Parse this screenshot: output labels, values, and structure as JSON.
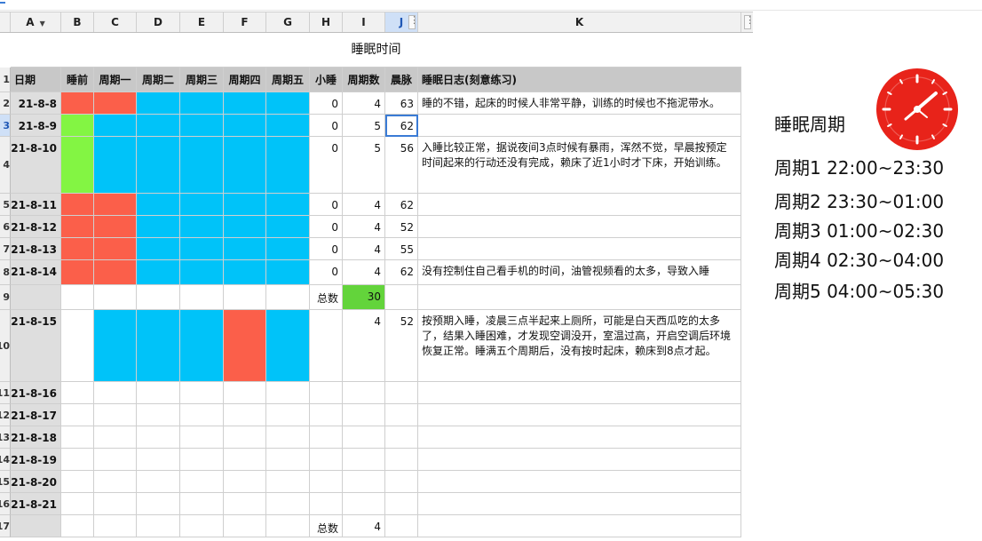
{
  "columns": [
    "A",
    "B",
    "C",
    "D",
    "E",
    "F",
    "G",
    "H",
    "I",
    "J",
    "K"
  ],
  "selected_column": "J",
  "sheet_title": "睡眠时间",
  "headers": {
    "date": "日期",
    "before_sleep": "睡前",
    "c1": "周期一",
    "c2": "周期二",
    "c3": "周期三",
    "c4": "周期四",
    "c5": "周期五",
    "nap": "小睡",
    "cycles": "周期数",
    "pulse": "晨脉",
    "log": "睡眠日志(刻意练习)"
  },
  "header_row_number": "1",
  "rows": [
    {
      "rn": "2",
      "date": "21-8-8",
      "nap": "0",
      "cycles": "4",
      "pulse": "63",
      "log": "睡的不错，起床的时候人非常平静，训练的时候也不拖泥带水。"
    },
    {
      "rn": "3",
      "date": "21-8-9",
      "nap": "0",
      "cycles": "5",
      "pulse": "62",
      "log": ""
    },
    {
      "rn": "4",
      "date": "21-8-10",
      "nap": "0",
      "cycles": "5",
      "pulse": "56",
      "log": "入睡比较正常，据说夜间3点时候有暴雨，浑然不觉，早晨按预定时间起来的行动还没有完成，赖床了近1小时才下床，开始训练。"
    },
    {
      "rn": "5",
      "date": "21-8-11",
      "nap": "0",
      "cycles": "4",
      "pulse": "62",
      "log": ""
    },
    {
      "rn": "6",
      "date": "21-8-12",
      "nap": "0",
      "cycles": "4",
      "pulse": "52",
      "log": ""
    },
    {
      "rn": "7",
      "date": "21-8-13",
      "nap": "0",
      "cycles": "4",
      "pulse": "55",
      "log": ""
    },
    {
      "rn": "8",
      "date": "21-8-14",
      "nap": "0",
      "cycles": "4",
      "pulse": "62",
      "log": "没有控制住自己看手机的时间，油管视频看的太多，导致入睡"
    },
    {
      "rn": "9",
      "date": "",
      "nap": "总数",
      "cycles": "30",
      "pulse": "",
      "log": ""
    },
    {
      "rn": "10",
      "date": "21-8-15",
      "nap": "",
      "cycles": "4",
      "pulse": "52",
      "log": "按预期入睡，凌晨三点半起来上厕所，可能是白天西瓜吃的太多了，结果入睡困难，才发现空调没开，室温过高，开启空调后环境恢复正常。睡满五个周期后，没有按时起床，赖床到8点才起。"
    },
    {
      "rn": "11",
      "date": "21-8-16",
      "nap": "",
      "cycles": "",
      "pulse": "",
      "log": ""
    },
    {
      "rn": "12",
      "date": "21-8-17",
      "nap": "",
      "cycles": "",
      "pulse": "",
      "log": ""
    },
    {
      "rn": "13",
      "date": "21-8-18",
      "nap": "",
      "cycles": "",
      "pulse": "",
      "log": ""
    },
    {
      "rn": "14",
      "date": "21-8-19",
      "nap": "",
      "cycles": "",
      "pulse": "",
      "log": ""
    },
    {
      "rn": "15",
      "date": "21-8-20",
      "nap": "",
      "cycles": "",
      "pulse": "",
      "log": ""
    },
    {
      "rn": "16",
      "date": "21-8-21",
      "nap": "",
      "cycles": "",
      "pulse": "",
      "log": ""
    },
    {
      "rn": "17",
      "date": "",
      "nap": "总数",
      "cycles": "4",
      "pulse": "",
      "log": ""
    }
  ],
  "cell_fills": [
    [
      "red",
      "red",
      "blue",
      "blue",
      "blue",
      "blue"
    ],
    [
      "green",
      "blue",
      "blue",
      "blue",
      "blue",
      "blue"
    ],
    [
      "green",
      "blue",
      "blue",
      "blue",
      "blue",
      "blue"
    ],
    [
      "red",
      "red",
      "blue",
      "blue",
      "blue",
      "blue"
    ],
    [
      "red",
      "red",
      "blue",
      "blue",
      "blue",
      "blue"
    ],
    [
      "red",
      "red",
      "blue",
      "blue",
      "blue",
      "blue"
    ],
    [
      "red",
      "red",
      "blue",
      "blue",
      "blue",
      "blue"
    ],
    [
      "",
      "",
      "",
      "",
      "",
      ""
    ],
    [
      "",
      "blue",
      "blue",
      "blue",
      "red",
      "blue"
    ],
    [
      "",
      "",
      "",
      "",
      "",
      ""
    ],
    [
      "",
      "",
      "",
      "",
      "",
      ""
    ],
    [
      "",
      "",
      "",
      "",
      "",
      ""
    ],
    [
      "",
      "",
      "",
      "",
      "",
      ""
    ],
    [
      "",
      "",
      "",
      "",
      "",
      ""
    ],
    [
      "",
      "",
      "",
      "",
      "",
      ""
    ],
    [
      "",
      "",
      "",
      "",
      "",
      ""
    ]
  ],
  "colors": {
    "red": "#fb5f4a",
    "blue": "#00c3f9",
    "green": "#83f543",
    "sum_green": "#63d43b",
    "clock_red": "#e8231a",
    "selection": "#3a7bd5"
  },
  "panel": {
    "title": "睡眠周期",
    "cycles": [
      "周期1 22:00~23:30",
      "周期2 23:30~01:00",
      "周期3 01:00~02:30",
      "周期4 02:30~04:00",
      "周期5 04:00~05:30"
    ],
    "clock_icon": "clock-icon"
  }
}
